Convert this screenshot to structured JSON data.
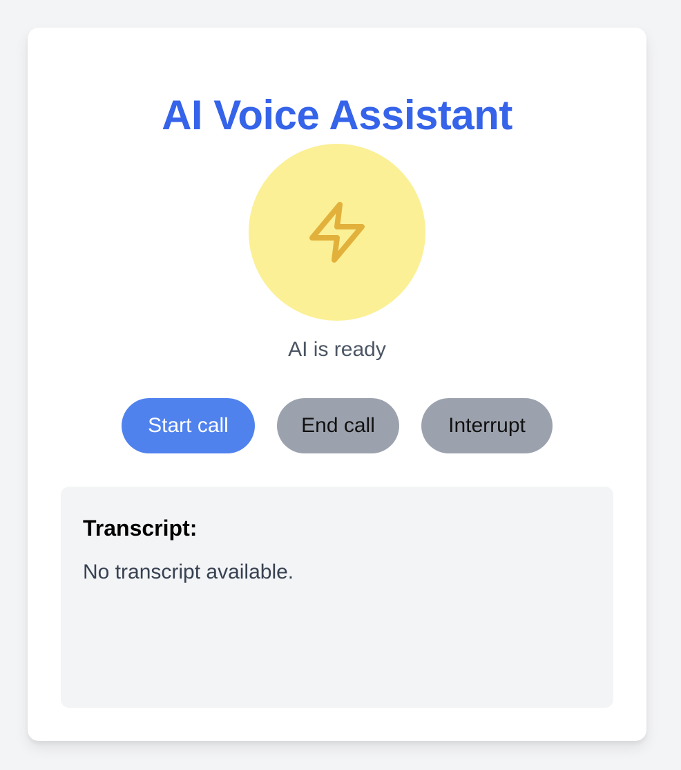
{
  "app": {
    "title": "AI Voice Assistant",
    "status": "AI is ready"
  },
  "avatar": {
    "icon": "lightning-bolt-icon"
  },
  "controls": {
    "start_label": "Start call",
    "end_label": "End call",
    "interrupt_label": "Interrupt"
  },
  "transcript": {
    "heading": "Transcript:",
    "text": "No transcript available."
  },
  "colors": {
    "title": "#3563e9",
    "avatar_bg": "#fbf095",
    "icon": "#e2b13c",
    "start_button": "#5082ee",
    "disabled_button": "#9ca2ad"
  }
}
